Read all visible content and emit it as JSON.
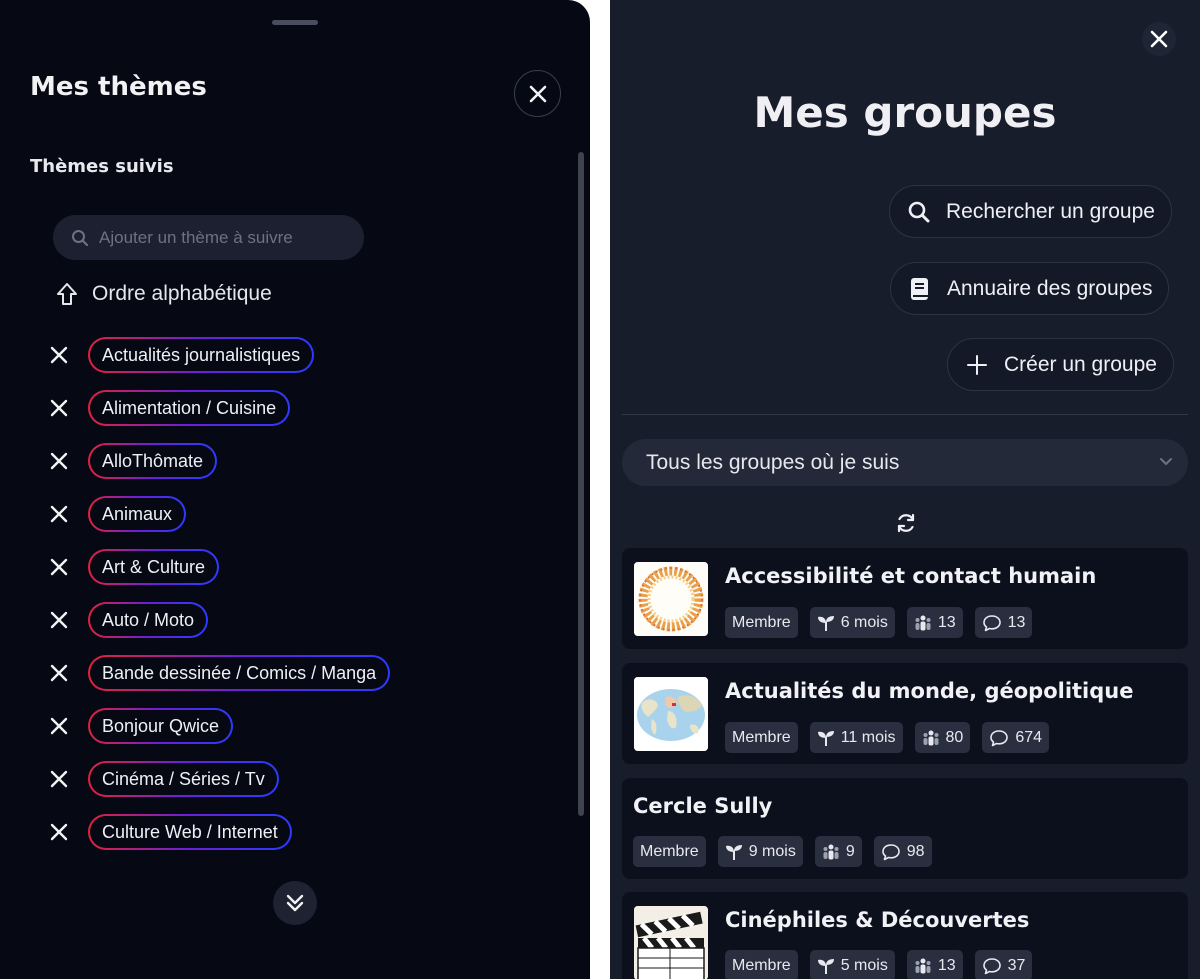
{
  "left_panel": {
    "title": "Mes thèmes",
    "section_title": "Thèmes suivis",
    "search_placeholder": "Ajouter un thème à suivre",
    "sort_label": "Ordre alphabétique",
    "themes": [
      "Actualités journalistiques",
      "Alimentation / Cuisine",
      "AlloThômate",
      "Animaux",
      "Art & Culture",
      "Auto / Moto",
      "Bande dessinée / Comics / Manga",
      "Bonjour Qwice",
      "Cinéma / Séries / Tv",
      "Culture Web / Internet"
    ]
  },
  "right_panel": {
    "title": "Mes groupes",
    "search_button": "Rechercher un groupe",
    "directory_button": "Annuaire des groupes",
    "create_button": "Créer un groupe",
    "filter_select": "Tous les groupes où je suis",
    "groups": [
      {
        "name": "Accessibilité et contact humain",
        "role": "Membre",
        "age": "6 mois",
        "members": "13",
        "messages": "13",
        "thumb": "sun-circle"
      },
      {
        "name": "Actualités du monde, géopolitique",
        "role": "Membre",
        "age": "11 mois",
        "members": "80",
        "messages": "674",
        "thumb": "world-map"
      },
      {
        "name": "Cercle Sully",
        "role": "Membre",
        "age": "9 mois",
        "members": "9",
        "messages": "98",
        "thumb": ""
      },
      {
        "name": "Cinéphiles & Découvertes",
        "role": "Membre",
        "age": "5 mois",
        "members": "13",
        "messages": "37",
        "thumb": "clapperboard"
      }
    ]
  },
  "colors": {
    "left_bg": "#060914",
    "right_bg": "#181d2b",
    "pill_gradient_start": "#e3213b",
    "pill_gradient_end": "#2b3bff"
  }
}
